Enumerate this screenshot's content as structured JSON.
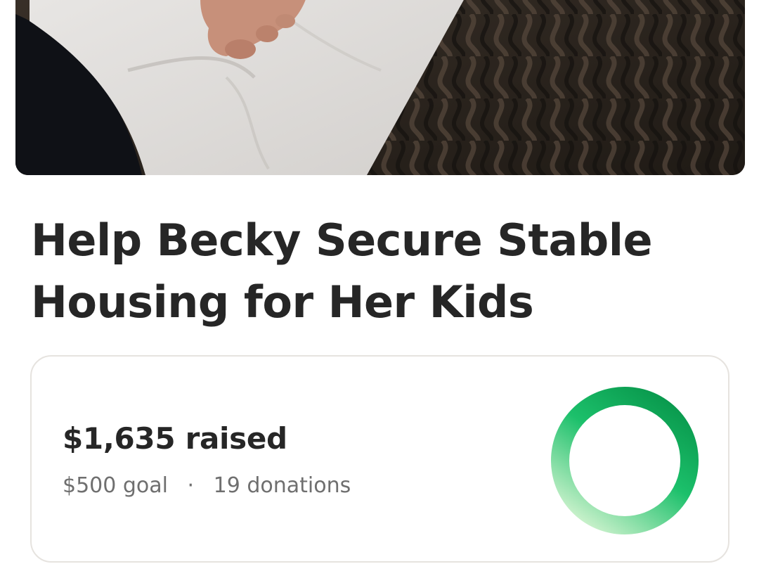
{
  "campaign": {
    "title": "Help Becky Secure Stable Housing for Her Kids"
  },
  "progress": {
    "raised_label": "$1,635 raised",
    "goal_label": "$500 goal",
    "separator": "·",
    "donations_label": "19 donations",
    "progress_fraction": 1.0
  },
  "colors": {
    "ring_dark": "#0a9a4e",
    "ring_mid": "#1cc06b",
    "ring_light": "#c6f0c9",
    "title_text": "#262626",
    "meta_text": "#6f6f6f",
    "card_border": "#e6e3df"
  },
  "hero": {
    "description_icon": "campaign-photo"
  }
}
